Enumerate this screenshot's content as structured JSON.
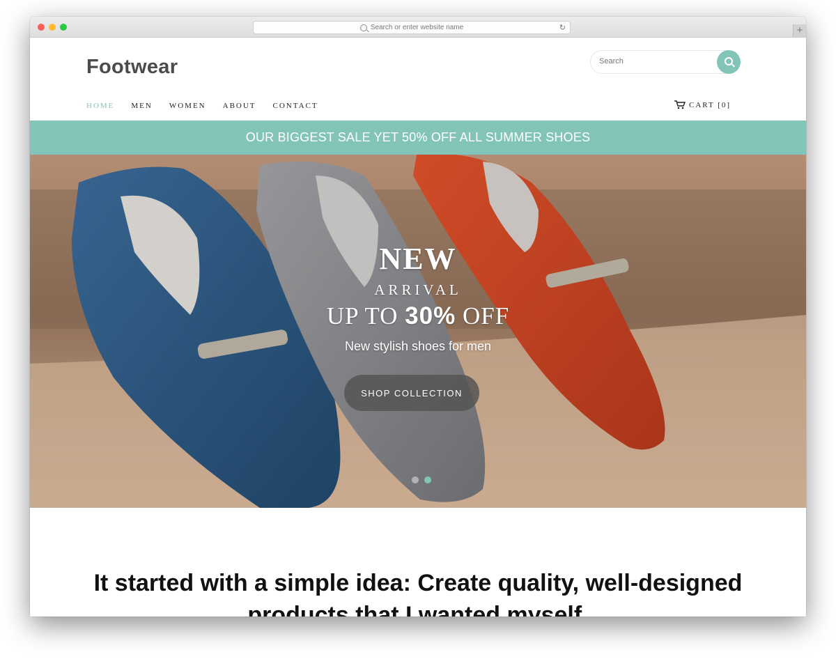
{
  "browser": {
    "url_placeholder": "Search or enter website name",
    "reload_glyph": "↻",
    "new_tab_glyph": "+"
  },
  "site": {
    "logo": "Footwear",
    "search_placeholder": "Search",
    "nav": [
      "HOME",
      "MEN",
      "WOMEN",
      "ABOUT",
      "CONTACT"
    ],
    "active_nav": "HOME",
    "cart_label": "CART [0]"
  },
  "banner": {
    "text": "OUR BIGGEST SALE YET 50% OFF ALL SUMMER SHOES",
    "color": "#82c5b8"
  },
  "hero": {
    "line1": "NEW",
    "line2": "ARRIVAL",
    "line3_prefix": "UP TO ",
    "line3_bold": "30%",
    "line3_suffix": " OFF",
    "subtitle": "New stylish shoes for men",
    "cta": "SHOP COLLECTION",
    "slides": 2,
    "active_slide": 2
  },
  "story": {
    "heading": "It started with a simple idea: Create quality, well-designed products that I wanted myself."
  },
  "icons": [
    "search-icon",
    "cart-icon",
    "reload-icon",
    "plus-icon"
  ]
}
